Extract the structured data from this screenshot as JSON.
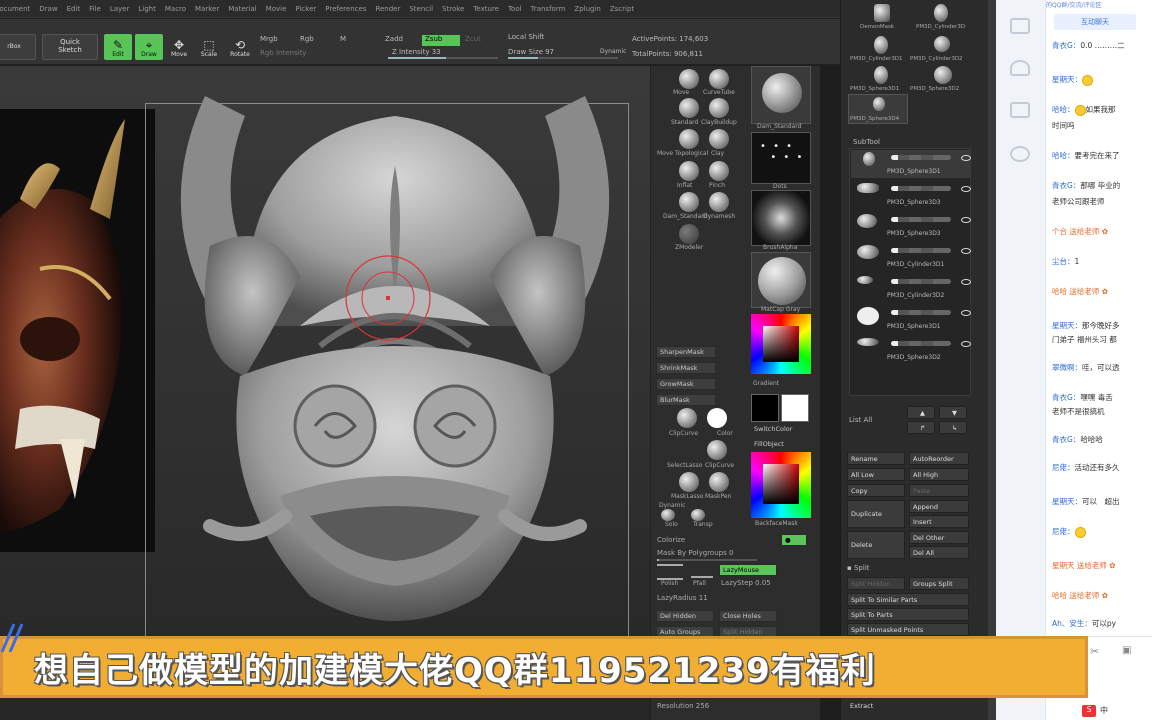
{
  "menubar": [
    "Document",
    "Draw",
    "Edit",
    "File",
    "Layer",
    "Light",
    "Macro",
    "Marker",
    "Material",
    "Movie",
    "Picker",
    "Preferences",
    "Render",
    "Stencil",
    "Stroke",
    "Texture",
    "Tool",
    "Transform",
    "Zplugin",
    "Zscript"
  ],
  "toolbar": {
    "lightbox": "rBox",
    "quick_sketch": "Quick\nSketch",
    "edit": "Edit",
    "draw": "Draw",
    "move": "Move",
    "scale": "Scale",
    "rotate": "Rotate",
    "mrgb": "Mrgb",
    "rgb": "Rgb",
    "m": "M",
    "rgb_intensity": "Rgb Intensity",
    "zadd": "Zadd",
    "zsub": "Zsub",
    "zcut": "Zcut",
    "z_intensity": "Z Intensity 33",
    "local_shift": "Local Shift",
    "draw_size": "Draw Size 97",
    "dynamic": "Dynamic",
    "active_points": "ActivePoints: 174,603",
    "total_points": "TotalPoints: 906,811"
  },
  "palette": {
    "brushes": [
      "Move",
      "CurveTube",
      "Standard",
      "ClayBuildup",
      "Move Topological",
      "Clay",
      "Inflat",
      "Pinch",
      "Dam_Standard",
      "Dynamesh"
    ],
    "brush_big": "Dam_Standard",
    "zmodeler": "ZModeler",
    "dots": "Dots",
    "alpha": "BrushAlpha",
    "material": "MatCap Gray",
    "mask_buttons": [
      "SharpenMask",
      "ShrinkMask",
      "GrowMask",
      "BlurMask"
    ],
    "clip": [
      "ClipCurve",
      "Color"
    ],
    "select": [
      "SelectLasso",
      "ClipCurve"
    ],
    "mask_lasso": [
      "MaskLasso",
      "MaskPen"
    ],
    "dynamic": "Dynamic",
    "solo": "Solo",
    "transp": "Transp",
    "colorize": "Colorize",
    "gradient": "Gradient",
    "switch_color": "SwitchColor",
    "fill_object": "FillObject",
    "backface_mask": "BackfaceMask",
    "mask_by_polygroups": "Mask By Polygroups 0",
    "polish": "Polish",
    "pfall": "Pfall",
    "lazy_mouse": "LazyMouse",
    "lazy_step": "LazyStep 0.05",
    "lazy_radius": "LazyRadius 11",
    "del_hidden": "Del Hidden",
    "close_holes": "Close Holes",
    "auto_groups": "Auto Groups",
    "split_hidden": "Split Hidden",
    "resolution": "Resolution 256"
  },
  "subtool": {
    "header": "SubTool",
    "top_items": [
      "DemonMask",
      "PM3D_Cylinder3D",
      "PM3D_Cylinder3D1",
      "PM3D_Cylinder3D2",
      "PM3D_Sphere3D1",
      "PM3D_Sphere3D2",
      "PM3D_Sphere3D4"
    ],
    "items": [
      "PM3D_Sphere3D1",
      "PM3D_Sphere3D3",
      "PM3D_Sphere3D3",
      "PM3D_Cylinder3D1",
      "PM3D_Cylinder3D2",
      "PM3D_Sphere3D1",
      "PM3D_Sphere3D2"
    ],
    "list_all": "List All",
    "rename": "Rename",
    "auto_reorder": "AutoReorder",
    "all_low": "All Low",
    "all_high": "All High",
    "copy": "Copy",
    "paste": "Paste",
    "duplicate": "Duplicate",
    "append": "Append",
    "insert": "Insert",
    "delete": "Delete",
    "del_other": "Del Other",
    "del_all": "Del All",
    "split": "Split",
    "split_hidden": "Split Hidden",
    "groups_split": "Groups Split",
    "split_similar": "Split To Similar Parts",
    "split_parts": "Split To Parts",
    "split_unmasked": "Split Unmasked Points",
    "extract": "Extract"
  },
  "chat": {
    "top_link": "的QQ群/交流/评论区",
    "tab": "互动聊天",
    "messages": [
      {
        "who": "青衣G：",
        "text": "0.0 ………二"
      },
      {
        "who": "星期天：",
        "text": "",
        "emoji": true
      },
      {
        "who": "哈哈：",
        "text": "如果我那",
        "emoji": true
      },
      {
        "who": "",
        "text": "时间吗"
      },
      {
        "who": "哈哈：",
        "text": "要考完在来了"
      },
      {
        "who": "青衣G：",
        "text": "那哪 毕业的"
      },
      {
        "who": "",
        "text": "老师公司跟老师"
      },
      {
        "who": "个合 送给老师",
        "text": "",
        "orange": true
      },
      {
        "who": "尘台：",
        "text": "1"
      },
      {
        "who": "哈哈 送给老师",
        "text": "",
        "orange": true
      },
      {
        "who": "星期天：",
        "text": "那今晚好多"
      },
      {
        "who": "",
        "text": "门弟子 福州头习 都"
      },
      {
        "who": "翠微啊：",
        "text": "哇，可以透"
      },
      {
        "who": "青衣G：",
        "text": "嘿嘿 毒舌"
      },
      {
        "who": "",
        "text": "老师不是很搞机"
      },
      {
        "who": "青衣G：",
        "text": "哈哈哈"
      },
      {
        "who": "尼佬：",
        "text": "活动还有多久"
      },
      {
        "who": "星期天：",
        "text": "可以　超出"
      },
      {
        "who": "尼佬：",
        "text": "",
        "emoji": true
      },
      {
        "who": "星期天 送给老师",
        "text": "",
        "orange": true
      },
      {
        "who": "哈哈 送给老师",
        "text": "",
        "orange": true
      },
      {
        "who": "Ah、安生：",
        "text": "可以py"
      }
    ]
  },
  "banner": {
    "text": "想自己做模型的加建模大佬QQ群119521239有福利"
  },
  "colors": {
    "accent_green": "#58c558",
    "banner_bg": "#f2ad33",
    "chat_blue": "#2d6bd8",
    "chat_orange": "#e36b2a"
  }
}
